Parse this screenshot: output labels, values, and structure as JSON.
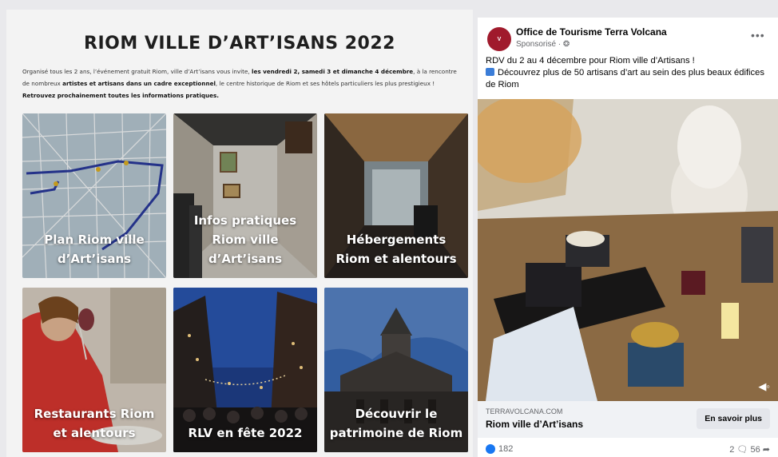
{
  "left": {
    "title": "RIOM VILLE D’ART’ISANS 2022",
    "intro_part1": "Organisé tous les 2 ans, l’événement gratuit Riom, ville d’Art’isans vous invite, ",
    "intro_bold1": "les vendredi 2, samedi 3 et dimanche 4 décembre",
    "intro_part2": ", à la rencontre de nombreux ",
    "intro_bold2": "artistes et artisans dans un cadre exceptionnel",
    "intro_part3": ", le centre historique de Riom et ses hôtels particuliers les plus prestigieux !",
    "intro_bold3": "Retrouvez prochainement toutes les informations pratiques.",
    "tiles": [
      {
        "label": "Plan Riom ville\nd’Art’isans"
      },
      {
        "label": "Infos pratiques\nRiom ville\nd’Art’isans"
      },
      {
        "label": "Hébergements\nRiom et alentours"
      },
      {
        "label": "Restaurants Riom\net alentours"
      },
      {
        "label": "RLV en fête 2022"
      },
      {
        "label": "Découvrir le\npatrimoine de Riom"
      }
    ]
  },
  "ad": {
    "page_name": "Office de Tourisme Terra Volcana",
    "sponsored": "Sponsorisé · ❂",
    "more": "•••",
    "text_line1": "RDV du 2 au 4 décembre  pour Riom ville d’Artisans !",
    "text_line2": "Découvrez plus de 50 artisans d’art au sein des plus beaux édifices de Riom",
    "link_domain": "TERRAVOLCANA.COM",
    "link_title": "Riom ville d’Art’isans",
    "cta": "En savoir plus",
    "likes": "182",
    "comments": "2",
    "shares": "56",
    "brand_color": "#a01a2c"
  }
}
